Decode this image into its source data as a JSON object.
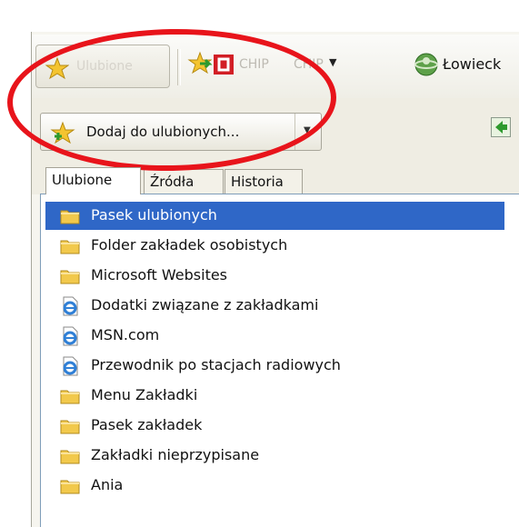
{
  "toolbar": {
    "favorites_button_label": "Ulubione",
    "links": [
      {
        "label": "CHIP",
        "icon": "chip-logo-icon"
      },
      {
        "label": "CHIP",
        "icon": "dropdown-arrow-icon"
      },
      {
        "label": "Łowieck",
        "icon": "globe-icon"
      }
    ]
  },
  "add_bar": {
    "add_label": "Dodaj do ulubionych...",
    "dropdown_icon": "chevron-down-icon",
    "sync_icon": "arrow-left-icon"
  },
  "tabs": [
    {
      "label": "Ulubione",
      "active": true
    },
    {
      "label": "Źródła",
      "active": false
    },
    {
      "label": "Historia",
      "active": false
    }
  ],
  "list": [
    {
      "label": "Pasek ulubionych",
      "icon": "folder-icon",
      "selected": true
    },
    {
      "label": "Folder zakładek osobistych",
      "icon": "folder-icon",
      "selected": false
    },
    {
      "label": "Microsoft Websites",
      "icon": "folder-icon",
      "selected": false
    },
    {
      "label": "Dodatki związane z zakładkami",
      "icon": "ie-page-icon",
      "selected": false
    },
    {
      "label": "MSN.com",
      "icon": "ie-page-icon",
      "selected": false
    },
    {
      "label": "Przewodnik po stacjach radiowych",
      "icon": "ie-page-icon",
      "selected": false
    },
    {
      "label": "Menu Zakładki",
      "icon": "folder-icon",
      "selected": false
    },
    {
      "label": "Pasek zakładek",
      "icon": "folder-icon",
      "selected": false
    },
    {
      "label": "Zakładki nieprzypisane",
      "icon": "folder-icon",
      "selected": false
    },
    {
      "label": "Ania",
      "icon": "folder-icon",
      "selected": false
    }
  ],
  "colors": {
    "selection": "#2f67c7",
    "annotation": "#e8141b",
    "folder": "#f2c94c"
  }
}
